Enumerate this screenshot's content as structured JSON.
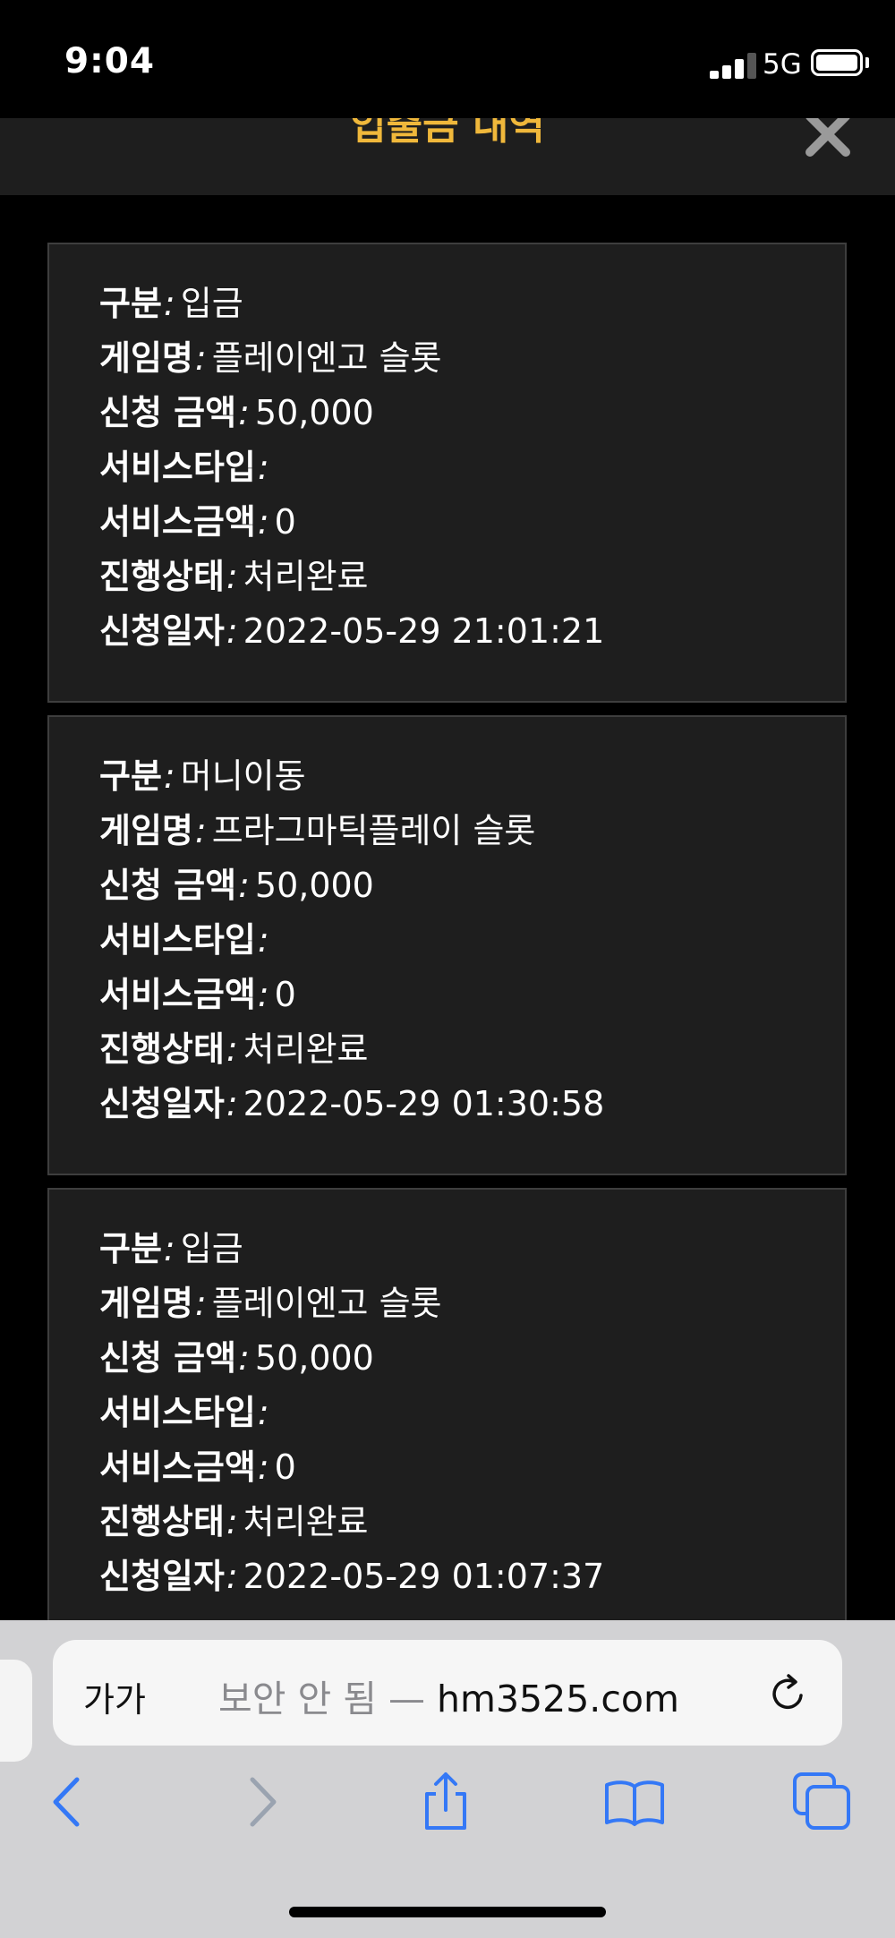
{
  "status_bar": {
    "time": "9:04",
    "network": "5G"
  },
  "modal": {
    "title": "입출금 내역"
  },
  "separator": ":",
  "labels": {
    "type": "구분",
    "game": "게임명",
    "amount": "신청 금액",
    "service_type": "서비스타입",
    "service_amount": "서비스금액",
    "status": "진행상태",
    "date": "신청일자"
  },
  "records": [
    {
      "type": "입금",
      "game": "플레이엔고 슬롯",
      "amount": "50,000",
      "service_type": "",
      "service_amount": "0",
      "status": "처리완료",
      "date": "2022-05-29 21:01:21"
    },
    {
      "type": "머니이동",
      "game": "프라그마틱플레이 슬롯",
      "amount": "50,000",
      "service_type": "",
      "service_amount": "0",
      "status": "처리완료",
      "date": "2022-05-29 01:30:58"
    },
    {
      "type": "입금",
      "game": "플레이엔고 슬롯",
      "amount": "50,000",
      "service_type": "",
      "service_amount": "0",
      "status": "처리완료",
      "date": "2022-05-29 01:07:37"
    }
  ],
  "browser": {
    "text_size_label": "가가",
    "insecure_label": "보안 안 됨 — ",
    "host": "hm3525.com"
  },
  "colors": {
    "accent": "#f0b83b",
    "card_bg": "#1e1e1e",
    "ios_blue": "#3478f6"
  },
  "icons": [
    "signal-icon",
    "battery-icon",
    "close-icon",
    "reload-icon",
    "back-icon",
    "forward-icon",
    "share-icon",
    "bookmarks-icon",
    "tabs-icon"
  ]
}
